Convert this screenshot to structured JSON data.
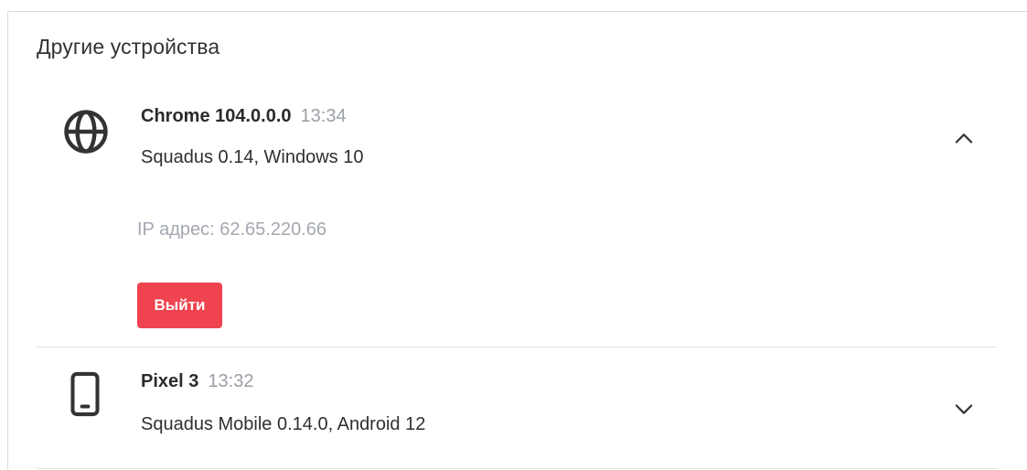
{
  "section": {
    "title": "Другие устройства"
  },
  "devices": [
    {
      "icon": "globe-icon",
      "name": "Chrome 104.0.0.0",
      "time": "13:34",
      "details": "Squadus 0.14, Windows 10",
      "expanded": true,
      "ip": "IP адрес: 62.65.220.66",
      "logout_label": "Выйти",
      "chevron": "chevron-up-icon"
    },
    {
      "icon": "smartphone-icon",
      "name": "Pixel 3",
      "time": "13:32",
      "details": "Squadus Mobile 0.14.0, Android 12",
      "expanded": false,
      "chevron": "chevron-down-icon"
    }
  ],
  "colors": {
    "logout_button": "#f04350",
    "muted_text": "#a4a8b0",
    "divider": "#e3e3e3"
  }
}
